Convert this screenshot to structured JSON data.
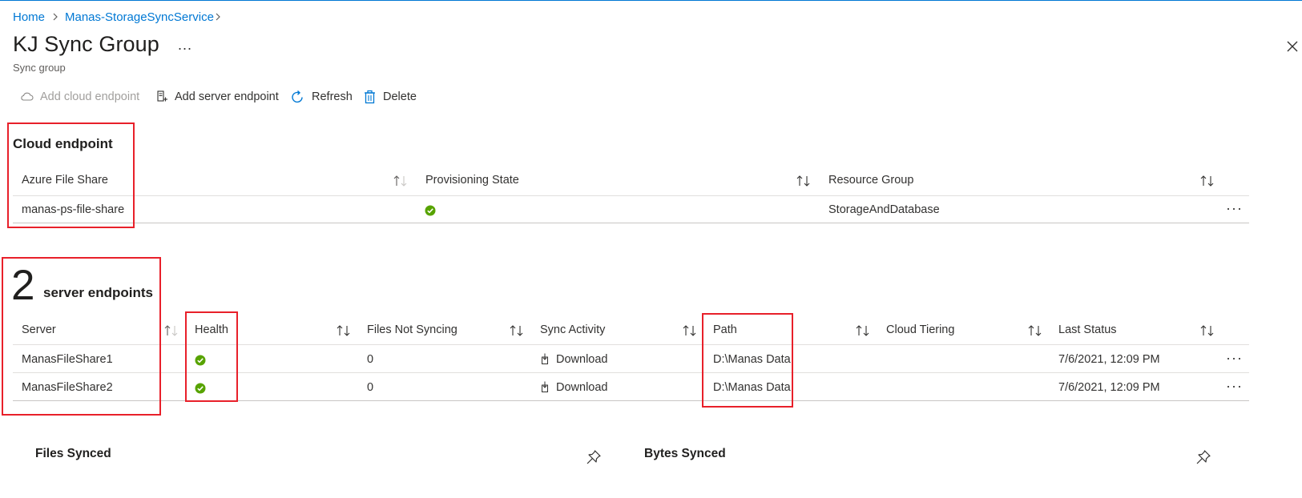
{
  "breadcrumb": {
    "items": [
      "Home",
      "Manas-StorageSyncService"
    ]
  },
  "header": {
    "title": "KJ Sync Group",
    "more": "...",
    "subtitle": "Sync group"
  },
  "toolbar": {
    "add_cloud_endpoint": "Add cloud endpoint",
    "add_server_endpoint": "Add server endpoint",
    "refresh": "Refresh",
    "delete": "Delete"
  },
  "cloud_endpoint": {
    "title": "Cloud endpoint",
    "columns": [
      "Azure File Share",
      "Provisioning State",
      "Resource Group"
    ],
    "rows": [
      {
        "share": "manas-ps-file-share",
        "state": "success",
        "resource_group": "StorageAndDatabase"
      }
    ]
  },
  "server_endpoints": {
    "count": "2",
    "label": "server endpoints",
    "columns": [
      "Server",
      "Health",
      "Files Not Syncing",
      "Sync Activity",
      "Path",
      "Cloud Tiering",
      "Last Status"
    ],
    "rows": [
      {
        "server": "ManasFileShare1",
        "health": "healthy",
        "files_not_syncing": "0",
        "sync_activity": "Download",
        "path": "D:\\Manas Data",
        "cloud_tiering": "",
        "last_status": "7/6/2021, 12:09 PM"
      },
      {
        "server": "ManasFileShare2",
        "health": "healthy",
        "files_not_syncing": "0",
        "sync_activity": "Download",
        "path": "D:\\Manas Data",
        "cloud_tiering": "",
        "last_status": "7/6/2021, 12:09 PM"
      }
    ]
  },
  "tiles": {
    "files_synced": "Files Synced",
    "bytes_synced": "Bytes Synced"
  },
  "colors": {
    "accent": "#0078d4",
    "success": "#57a300",
    "highlight": "#e8202a"
  },
  "icons": [
    "cloud-icon",
    "server-icon",
    "refresh-icon",
    "delete-icon",
    "sort-icon",
    "success-icon",
    "download-icon",
    "pin-icon",
    "close-icon",
    "more-icon"
  ]
}
